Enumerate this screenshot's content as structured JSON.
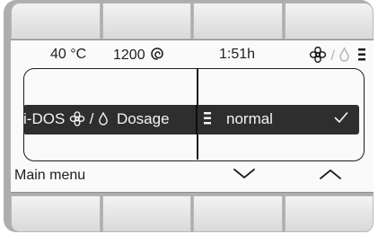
{
  "status": {
    "temperature": "40 °C",
    "spin_speed": "1200",
    "spin_icon": "spin-icon",
    "time_remaining": "1:51h",
    "icons": [
      "flower-icon",
      "drop-icon",
      "dosage-level-icon"
    ],
    "separator": "/"
  },
  "selection": {
    "left_label": "i-DOS",
    "left_separator": "/",
    "left_suffix": "Dosage",
    "right_label": "normal",
    "icons": [
      "flower-icon",
      "drop-icon",
      "dosage-level-icon",
      "check-icon"
    ]
  },
  "menu": {
    "main_menu_label": "Main menu",
    "down_icon": "chevron-down-icon",
    "up_icon": "chevron-up-icon"
  }
}
